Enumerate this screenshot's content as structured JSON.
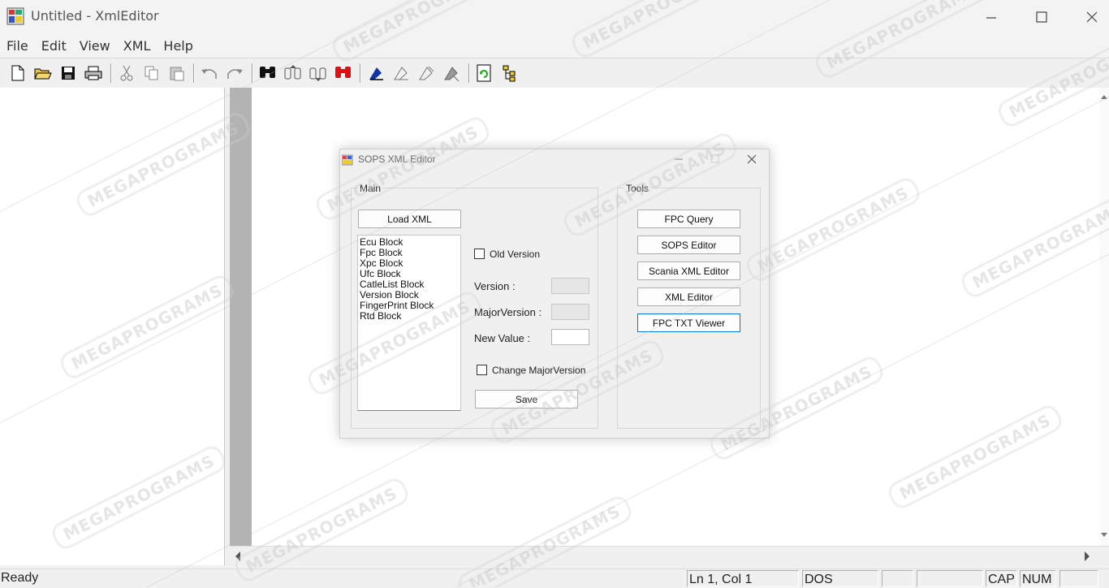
{
  "window": {
    "title": "Untitled - XmlEditor"
  },
  "menu": [
    "File",
    "Edit",
    "View",
    "XML",
    "Help"
  ],
  "toolbar": {
    "buttons": [
      "new-file-icon",
      "open-folder-icon",
      "save-icon",
      "print-icon",
      "cut-icon",
      "copy-icon",
      "paste-icon",
      "undo-icon",
      "redo-icon",
      "find-icon",
      "find-next-icon",
      "find-previous-icon",
      "find-highlight-icon",
      "validate-icon",
      "xpath-icon",
      "xslt-icon",
      "transform-icon",
      "refresh-icon",
      "tree-icon"
    ]
  },
  "status": {
    "ready": "Ready",
    "position": "Ln 1, Col 1",
    "line_ending": "DOS",
    "cap": "CAP",
    "num": "NUM"
  },
  "dialog": {
    "title": "SOPS XML Editor",
    "main_group": "Main",
    "tools_group": "Tools",
    "load_xml": "Load XML",
    "blocks": [
      "Ecu Block",
      "Fpc Block",
      "Xpc Block",
      "Ufc Block",
      "CatleList Block",
      "Version Block",
      "FingerPrint Block",
      "Rtd Block"
    ],
    "old_version": "Old Version",
    "version_label": "Version :",
    "major_version_label": "MajorVersion :",
    "new_value_label": "New Value :",
    "change_major": "Change MajorVersion",
    "save": "Save",
    "tools": [
      "FPC Query",
      "SOPS Editor",
      "Scania XML Editor",
      "XML Editor",
      "FPC TXT Viewer"
    ]
  },
  "watermark": "MEGAPROGRAMS",
  "colors": {
    "accent": "#0078d7",
    "gutter": "#b3b3b3"
  }
}
